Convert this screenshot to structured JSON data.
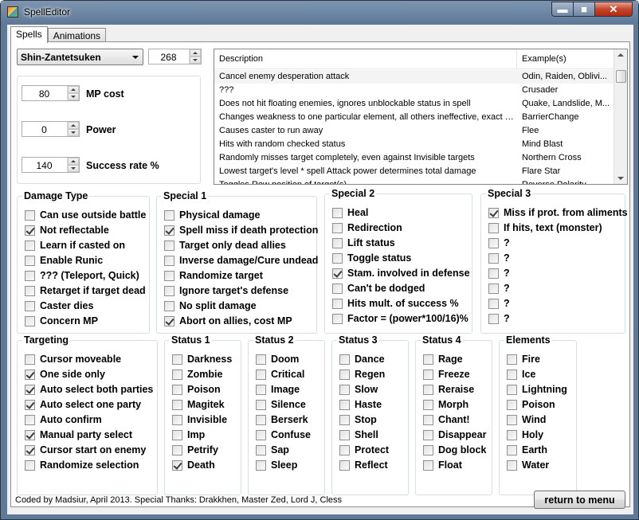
{
  "window": {
    "title": "SpellEditor",
    "minimize": "▬",
    "maximize": "■",
    "close": "✕"
  },
  "tabs": [
    {
      "label": "Spells",
      "active": true
    },
    {
      "label": "Animations",
      "active": false
    }
  ],
  "spell_select": {
    "value": "Shin-Zantetsuken"
  },
  "spell_id": {
    "value": "268"
  },
  "stats": [
    {
      "value": "80",
      "label": "MP cost"
    },
    {
      "value": "0",
      "label": "Power"
    },
    {
      "value": "140",
      "label": "Success rate %"
    }
  ],
  "effects_list": {
    "columns": [
      "Description",
      "Example(s)"
    ],
    "rows": [
      {
        "desc": "Cancel enemy desperation attack",
        "ex": "Odin, Raiden, Oblivi...",
        "selected": true
      },
      {
        "desc": "???",
        "ex": "Crusader"
      },
      {
        "desc": "Does not hit floating enemies, ignores unblockable status in spell",
        "ex": "Quake, Landslide, M..."
      },
      {
        "desc": "Changes weakness to one particular element, all others ineffective, exact op...",
        "ex": "BarrierChange"
      },
      {
        "desc": "Causes caster to run away",
        "ex": "Flee"
      },
      {
        "desc": "Hits with random checked status",
        "ex": "Mind Blast"
      },
      {
        "desc": "Randomly misses target completely, even against Invisible targets",
        "ex": "Northern Cross"
      },
      {
        "desc": "Lowest target's level * spell Attack power determines total damage",
        "ex": "Flare Star"
      },
      {
        "desc": "Toggles Row position of target(s)",
        "ex": "Reverse Polarity"
      }
    ]
  },
  "damage_type": {
    "title": "Damage Type",
    "items": [
      {
        "label": "Can use outside battle",
        "checked": false
      },
      {
        "label": "Not reflectable",
        "checked": true
      },
      {
        "label": "Learn if casted on",
        "checked": false
      },
      {
        "label": "Enable Runic",
        "checked": false
      },
      {
        "label": "??? (Teleport, Quick)",
        "checked": false
      },
      {
        "label": "Retarget if target dead",
        "checked": false
      },
      {
        "label": "Caster dies",
        "checked": false
      },
      {
        "label": "Concern MP",
        "checked": false
      }
    ]
  },
  "special1": {
    "title": "Special 1",
    "items": [
      {
        "label": "Physical damage",
        "checked": false
      },
      {
        "label": "Spell miss if death protection",
        "checked": true
      },
      {
        "label": "Target only dead allies",
        "checked": false
      },
      {
        "label": "Inverse damage/Cure undead",
        "checked": false
      },
      {
        "label": "Randomize target",
        "checked": false
      },
      {
        "label": "Ignore target's defense",
        "checked": false
      },
      {
        "label": "No split damage",
        "checked": false
      },
      {
        "label": "Abort on allies, cost MP",
        "checked": true
      }
    ]
  },
  "special2": {
    "title": "Special 2",
    "items": [
      {
        "label": "Heal",
        "checked": false
      },
      {
        "label": "Redirection",
        "checked": false
      },
      {
        "label": "Lift status",
        "checked": false
      },
      {
        "label": "Toggle status",
        "checked": false
      },
      {
        "label": "Stam. involved in defense",
        "checked": true
      },
      {
        "label": "Can't be dodged",
        "checked": false
      },
      {
        "label": "Hits mult. of success %",
        "checked": false
      },
      {
        "label": "Factor = (power*100/16)%",
        "checked": false
      }
    ]
  },
  "special3": {
    "title": "Special 3",
    "items": [
      {
        "label": "Miss if prot. from aliments",
        "checked": true
      },
      {
        "label": "If hits, text (monster)",
        "checked": false
      },
      {
        "label": "?",
        "checked": false
      },
      {
        "label": "?",
        "checked": false
      },
      {
        "label": "?",
        "checked": false
      },
      {
        "label": "?",
        "checked": false
      },
      {
        "label": "?",
        "checked": false
      },
      {
        "label": "?",
        "checked": false
      }
    ]
  },
  "targeting": {
    "title": "Targeting",
    "items": [
      {
        "label": "Cursor moveable",
        "checked": false
      },
      {
        "label": "One side only",
        "checked": true
      },
      {
        "label": "Auto select both parties",
        "checked": true
      },
      {
        "label": "Auto select one party",
        "checked": true
      },
      {
        "label": "Auto confirm",
        "checked": false
      },
      {
        "label": "Manual party select",
        "checked": true
      },
      {
        "label": "Cursor start on enemy",
        "checked": true
      },
      {
        "label": "Randomize selection",
        "checked": false
      }
    ]
  },
  "status1": {
    "title": "Status 1",
    "items": [
      {
        "label": "Darkness",
        "checked": false
      },
      {
        "label": "Zombie",
        "checked": false
      },
      {
        "label": "Poison",
        "checked": false
      },
      {
        "label": "Magitek",
        "checked": false
      },
      {
        "label": "Invisible",
        "checked": false
      },
      {
        "label": "Imp",
        "checked": false
      },
      {
        "label": "Petrify",
        "checked": false
      },
      {
        "label": "Death",
        "checked": true
      }
    ]
  },
  "status2": {
    "title": "Status 2",
    "items": [
      {
        "label": "Doom",
        "checked": false
      },
      {
        "label": "Critical",
        "checked": false
      },
      {
        "label": "Image",
        "checked": false
      },
      {
        "label": "Silence",
        "checked": false
      },
      {
        "label": "Berserk",
        "checked": false
      },
      {
        "label": "Confuse",
        "checked": false
      },
      {
        "label": "Sap",
        "checked": false
      },
      {
        "label": "Sleep",
        "checked": false
      }
    ]
  },
  "status3": {
    "title": "Status 3",
    "items": [
      {
        "label": "Dance",
        "checked": false
      },
      {
        "label": "Regen",
        "checked": false
      },
      {
        "label": "Slow",
        "checked": false
      },
      {
        "label": "Haste",
        "checked": false
      },
      {
        "label": "Stop",
        "checked": false
      },
      {
        "label": "Shell",
        "checked": false
      },
      {
        "label": "Protect",
        "checked": false
      },
      {
        "label": "Reflect",
        "checked": false
      }
    ]
  },
  "status4": {
    "title": "Status 4",
    "items": [
      {
        "label": "Rage",
        "checked": false
      },
      {
        "label": "Freeze",
        "checked": false
      },
      {
        "label": "Reraise",
        "checked": false
      },
      {
        "label": "Morph",
        "checked": false
      },
      {
        "label": "Chant!",
        "checked": false
      },
      {
        "label": "Disappear",
        "checked": false
      },
      {
        "label": "Dog block",
        "checked": false
      },
      {
        "label": "Float",
        "checked": false
      }
    ]
  },
  "elements": {
    "title": "Elements",
    "items": [
      {
        "label": "Fire",
        "checked": false
      },
      {
        "label": "Ice",
        "checked": false
      },
      {
        "label": "Lightning",
        "checked": false
      },
      {
        "label": "Poison",
        "checked": false
      },
      {
        "label": "Wind",
        "checked": false
      },
      {
        "label": "Holy",
        "checked": false
      },
      {
        "label": "Earth",
        "checked": false
      },
      {
        "label": "Water",
        "checked": false
      }
    ]
  },
  "footer": {
    "credits": "Coded by Madsiur, April 2013. Special Thanks: Drakkhen, Master Zed, Lord J,  Cless",
    "return_button": "return to menu"
  }
}
